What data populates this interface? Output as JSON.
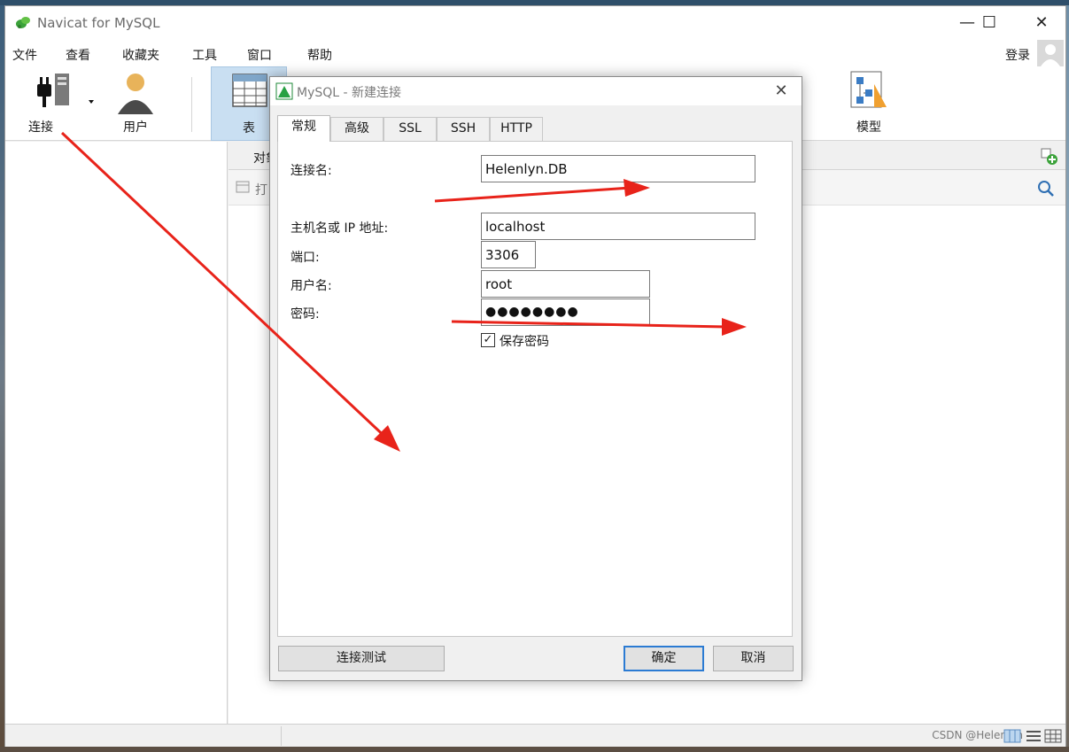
{
  "window": {
    "title": "Navicat for MySQL",
    "controls": {
      "minimize": "—",
      "maximize": "☐",
      "close": "✕"
    }
  },
  "menu": {
    "items": [
      "文件",
      "查看",
      "收藏夹",
      "工具",
      "窗口",
      "帮助"
    ],
    "login": "登录"
  },
  "toolbar": {
    "connect": "连接",
    "user": "用户",
    "table": "表",
    "model": "模型"
  },
  "object_tab": {
    "label": "对象",
    "open": "打"
  },
  "dialog": {
    "title": "MySQL - 新建连接",
    "close": "✕",
    "tabs": [
      "常规",
      "高级",
      "SSL",
      "SSH",
      "HTTP"
    ],
    "fields": {
      "connection_name_label": "连接名:",
      "connection_name_value": "Helenlyn.DB",
      "host_label": "主机名或 IP 地址:",
      "host_value": "localhost",
      "port_label": "端口:",
      "port_value": "3306",
      "user_label": "用户名:",
      "user_value": "root",
      "password_label": "密码:",
      "password_value": "●●●●●●●●"
    },
    "save_password": {
      "label": "保存密码",
      "checked": true,
      "mark": "✓"
    },
    "buttons": {
      "test": "连接测试",
      "ok": "确定",
      "cancel": "取消"
    }
  },
  "status": {
    "watermark": "CSDN @Helenlyn"
  },
  "colors": {
    "annotation_arrow": "#e8231a",
    "accent": "#2b7bd3",
    "navicat_green": "#3ba23a"
  }
}
